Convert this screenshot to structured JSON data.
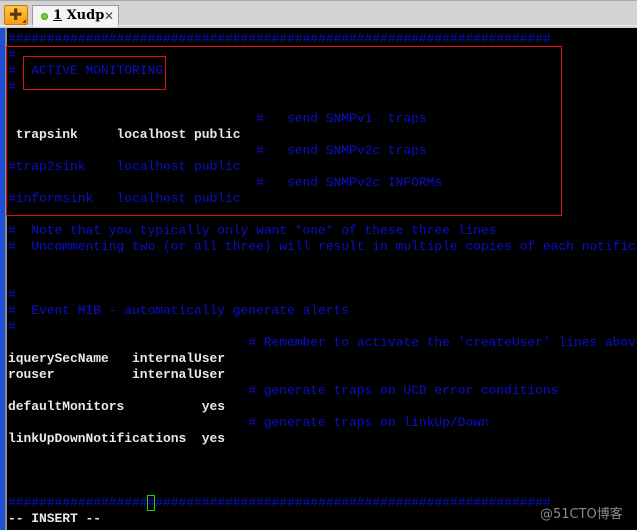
{
  "tabbar": {
    "new_tab_icon": "plus-icon",
    "tab": {
      "status": "connected",
      "number": "1",
      "title": "Xudp",
      "close_icon": "close-icon"
    }
  },
  "editor": {
    "lines": [
      {
        "text": "######################################################################",
        "style": "blue"
      },
      {
        "text": "#",
        "style": "blue"
      },
      {
        "text": "#  ACTIVE MONITORING",
        "style": "blue"
      },
      {
        "text": "#",
        "style": "blue"
      },
      {
        "text": "",
        "style": "blue"
      },
      {
        "text": "                                #   send SNMPv1  traps",
        "style": "blue"
      },
      {
        "text": " trapsink     localhost public",
        "style": "white"
      },
      {
        "text": "                                #   send SNMPv2c traps",
        "style": "blue"
      },
      {
        "text": "#trap2sink    localhost public",
        "style": "blue"
      },
      {
        "text": "                                #   send SNMPv2c INFORMs",
        "style": "blue"
      },
      {
        "text": "#informsink   localhost public",
        "style": "blue"
      },
      {
        "text": "",
        "style": "blue"
      },
      {
        "text": "#  Note that you typically only want *one* of these three lines",
        "style": "blue"
      },
      {
        "text": "#  Uncommenting two (or all three) will result in multiple copies of each notification.",
        "style": "blue"
      },
      {
        "text": "",
        "style": "blue"
      },
      {
        "text": "",
        "style": "blue"
      },
      {
        "text": "#",
        "style": "blue"
      },
      {
        "text": "#  Event MIB - automatically generate alerts",
        "style": "blue"
      },
      {
        "text": "#",
        "style": "blue"
      },
      {
        "text": "                               # Remember to activate the 'createUser' lines above",
        "style": "blue"
      },
      {
        "text": "iquerySecName   internalUser",
        "style": "white"
      },
      {
        "text": "rouser          internalUser",
        "style": "white"
      },
      {
        "text": "                               # generate traps on UCD error conditions",
        "style": "blue"
      },
      {
        "text": "defaultMonitors          yes",
        "style": "white"
      },
      {
        "text": "                               # generate traps on linkUp/Down",
        "style": "blue"
      },
      {
        "text": "linkUpDownNotifications  yes",
        "style": "white"
      },
      {
        "text": "",
        "style": "blue"
      },
      {
        "text": "",
        "style": "blue"
      },
      {
        "text": "",
        "style": "blue"
      },
      {
        "text": "######################################################################",
        "style": "blue"
      }
    ],
    "mode": "-- INSERT --"
  },
  "watermark": "@51CTO博客",
  "colors": {
    "comment": "#0a10c8",
    "code": "#e8e8e8",
    "highlight_box": "#e01010",
    "cursor": "#20d020"
  }
}
